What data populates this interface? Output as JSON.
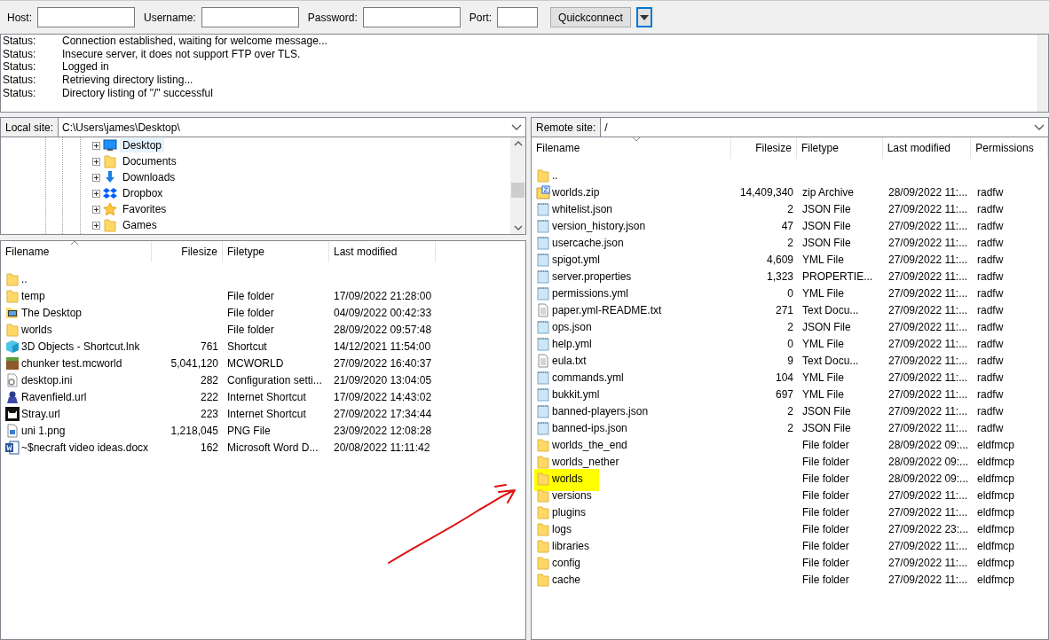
{
  "quickconnect": {
    "fields": [
      {
        "label": "Host:"
      },
      {
        "label": "Username:"
      },
      {
        "label": "Password:"
      },
      {
        "label": "Port:"
      }
    ],
    "button": "Quickconnect"
  },
  "log": [
    {
      "label": "Status:",
      "message": "Connection established, waiting for welcome message..."
    },
    {
      "label": "Status:",
      "message": "Insecure server, it does not support FTP over TLS."
    },
    {
      "label": "Status:",
      "message": "Logged in"
    },
    {
      "label": "Status:",
      "message": "Retrieving directory listing..."
    },
    {
      "label": "Status:",
      "message": "Directory listing of \"/\" successful"
    }
  ],
  "local": {
    "site_label": "Local site:",
    "path": "C:\\Users\\james\\Desktop\\",
    "tree": [
      {
        "label": "Desktop",
        "kind": "desktop",
        "selected": true
      },
      {
        "label": "Documents",
        "kind": "folder",
        "selected": false
      },
      {
        "label": "Downloads",
        "kind": "download",
        "selected": false
      },
      {
        "label": "Dropbox",
        "kind": "dropbox",
        "selected": false
      },
      {
        "label": "Favorites",
        "kind": "star",
        "selected": false
      },
      {
        "label": "Games",
        "kind": "folder",
        "selected": false
      }
    ],
    "columns": [
      {
        "label": "Filename"
      },
      {
        "label": "Filesize"
      },
      {
        "label": "Filetype"
      },
      {
        "label": "Last modified"
      }
    ],
    "rows": [
      {
        "name": "..",
        "kind": "folder",
        "highlighted": false
      },
      {
        "name": "temp",
        "kind": "folder",
        "type": "File folder",
        "modified": "17/09/2022 21:28:00",
        "highlighted": false
      },
      {
        "name": "The Desktop",
        "kind": "desktop-folder",
        "type": "File folder",
        "modified": "04/09/2022 00:42:33",
        "highlighted": false
      },
      {
        "name": "worlds",
        "kind": "folder",
        "type": "File folder",
        "modified": "28/09/2022 09:57:48",
        "highlighted": false
      },
      {
        "name": "3D Objects - Shortcut.lnk",
        "kind": "cube",
        "size": "761",
        "type": "Shortcut",
        "modified": "14/12/2021 11:54:00",
        "highlighted": false
      },
      {
        "name": "chunker test.mcworld",
        "kind": "grass",
        "size": "5,041,120",
        "type": "MCWORLD",
        "modified": "27/09/2022 16:40:37",
        "highlighted": false
      },
      {
        "name": "desktop.ini",
        "kind": "settings-file",
        "size": "282",
        "type": "Configuration setti...",
        "modified": "21/09/2020 13:04:05",
        "highlighted": false
      },
      {
        "name": "Ravenfield.url",
        "kind": "game",
        "size": "222",
        "type": "Internet Shortcut",
        "modified": "17/09/2022 14:43:02",
        "highlighted": false
      },
      {
        "name": "Stray.url",
        "kind": "cat",
        "size": "223",
        "type": "Internet Shortcut",
        "modified": "27/09/2022 17:34:44",
        "highlighted": false
      },
      {
        "name": "uni 1.png",
        "kind": "image",
        "size": "1,218,045",
        "type": "PNG File",
        "modified": "23/09/2022 12:08:28",
        "highlighted": false
      },
      {
        "name": "~$necraft video ideas.docx",
        "kind": "word",
        "size": "162",
        "type": "Microsoft Word D...",
        "modified": "20/08/2022 11:11:42",
        "highlighted": false
      }
    ]
  },
  "remote": {
    "site_label": "Remote site:",
    "path": "/",
    "columns": [
      {
        "label": "Filename"
      },
      {
        "label": "Filesize"
      },
      {
        "label": "Filetype"
      },
      {
        "label": "Last modified"
      },
      {
        "label": "Permissions"
      }
    ],
    "rows": [
      {
        "name": "..",
        "kind": "folder",
        "highlighted": false
      },
      {
        "name": "worlds.zip",
        "kind": "zip",
        "size": "14,409,340",
        "type": "zip Archive",
        "modified": "28/09/2022 11:...",
        "permissions": "radfw",
        "highlighted": false
      },
      {
        "name": "whitelist.json",
        "kind": "data",
        "size": "2",
        "type": "JSON File",
        "modified": "27/09/2022 11:...",
        "permissions": "radfw",
        "highlighted": false
      },
      {
        "name": "version_history.json",
        "kind": "data",
        "size": "47",
        "type": "JSON File",
        "modified": "27/09/2022 11:...",
        "permissions": "radfw",
        "highlighted": false
      },
      {
        "name": "usercache.json",
        "kind": "data",
        "size": "2",
        "type": "JSON File",
        "modified": "27/09/2022 11:...",
        "permissions": "radfw",
        "highlighted": false
      },
      {
        "name": "spigot.yml",
        "kind": "data",
        "size": "4,609",
        "type": "YML File",
        "modified": "27/09/2022 11:...",
        "permissions": "radfw",
        "highlighted": false
      },
      {
        "name": "server.properties",
        "kind": "data",
        "size": "1,323",
        "type": "PROPERTIE...",
        "modified": "27/09/2022 11:...",
        "permissions": "radfw",
        "highlighted": false
      },
      {
        "name": "permissions.yml",
        "kind": "data",
        "size": "0",
        "type": "YML File",
        "modified": "27/09/2022 11:...",
        "permissions": "radfw",
        "highlighted": false
      },
      {
        "name": "paper.yml-README.txt",
        "kind": "text",
        "size": "271",
        "type": "Text Docu...",
        "modified": "27/09/2022 11:...",
        "permissions": "radfw",
        "highlighted": false
      },
      {
        "name": "ops.json",
        "kind": "data",
        "size": "2",
        "type": "JSON File",
        "modified": "27/09/2022 11:...",
        "permissions": "radfw",
        "highlighted": false
      },
      {
        "name": "help.yml",
        "kind": "data",
        "size": "0",
        "type": "YML File",
        "modified": "27/09/2022 11:...",
        "permissions": "radfw",
        "highlighted": false
      },
      {
        "name": "eula.txt",
        "kind": "text",
        "size": "9",
        "type": "Text Docu...",
        "modified": "27/09/2022 11:...",
        "permissions": "radfw",
        "highlighted": false
      },
      {
        "name": "commands.yml",
        "kind": "data",
        "size": "104",
        "type": "YML File",
        "modified": "27/09/2022 11:...",
        "permissions": "radfw",
        "highlighted": false
      },
      {
        "name": "bukkit.yml",
        "kind": "data",
        "size": "697",
        "type": "YML File",
        "modified": "27/09/2022 11:...",
        "permissions": "radfw",
        "highlighted": false
      },
      {
        "name": "banned-players.json",
        "kind": "data",
        "size": "2",
        "type": "JSON File",
        "modified": "27/09/2022 11:...",
        "permissions": "radfw",
        "highlighted": false
      },
      {
        "name": "banned-ips.json",
        "kind": "data",
        "size": "2",
        "type": "JSON File",
        "modified": "27/09/2022 11:...",
        "permissions": "radfw",
        "highlighted": false
      },
      {
        "name": "worlds_the_end",
        "kind": "folder",
        "type": "File folder",
        "modified": "28/09/2022 09:...",
        "permissions": "eldfmcp",
        "highlighted": false
      },
      {
        "name": "worlds_nether",
        "kind": "folder",
        "type": "File folder",
        "modified": "28/09/2022 09:...",
        "permissions": "eldfmcp",
        "highlighted": false
      },
      {
        "name": "worlds",
        "kind": "folder",
        "type": "File folder",
        "modified": "28/09/2022 09:...",
        "permissions": "eldfmcp",
        "highlighted": true
      },
      {
        "name": "versions",
        "kind": "folder",
        "type": "File folder",
        "modified": "27/09/2022 11:...",
        "permissions": "eldfmcp",
        "highlighted": false
      },
      {
        "name": "plugins",
        "kind": "folder",
        "type": "File folder",
        "modified": "27/09/2022 11:...",
        "permissions": "eldfmcp",
        "highlighted": false
      },
      {
        "name": "logs",
        "kind": "folder",
        "type": "File folder",
        "modified": "27/09/2022 23:...",
        "permissions": "eldfmcp",
        "highlighted": false
      },
      {
        "name": "libraries",
        "kind": "folder",
        "type": "File folder",
        "modified": "27/09/2022 11:...",
        "permissions": "eldfmcp",
        "highlighted": false
      },
      {
        "name": "config",
        "kind": "folder",
        "type": "File folder",
        "modified": "27/09/2022 11:...",
        "permissions": "eldfmcp",
        "highlighted": false
      },
      {
        "name": "cache",
        "kind": "folder",
        "type": "File folder",
        "modified": "27/09/2022 11:...",
        "permissions": "eldfmcp",
        "highlighted": false
      }
    ]
  }
}
